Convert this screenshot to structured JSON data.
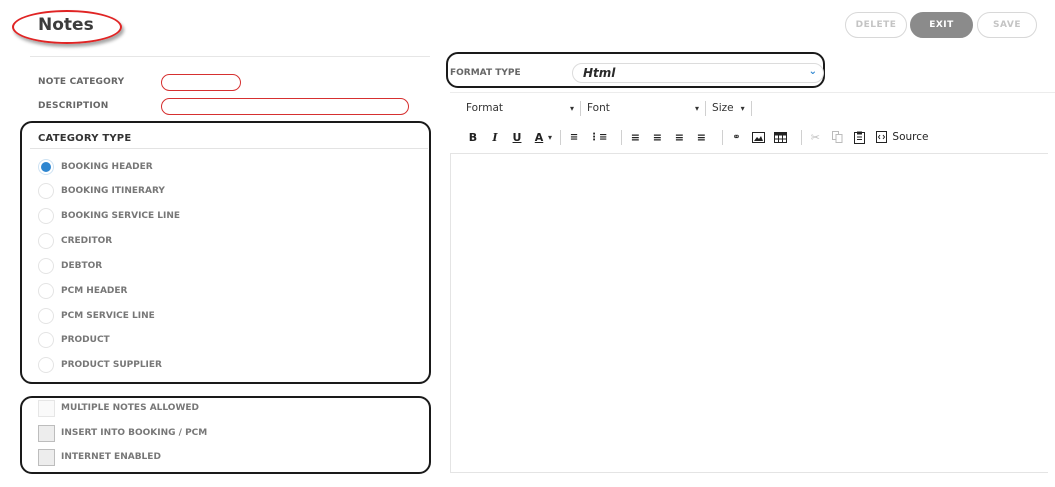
{
  "header": {
    "title": "Notes",
    "buttons": {
      "delete": "DELETE",
      "exit": "EXIT",
      "save": "SAVE"
    }
  },
  "form": {
    "note_category_label": "NOTE CATEGORY",
    "description_label": "DESCRIPTION",
    "note_category_value": "",
    "description_value": ""
  },
  "category_type": {
    "heading": "CATEGORY TYPE",
    "options": [
      {
        "label": "BOOKING HEADER",
        "selected": true
      },
      {
        "label": "BOOKING ITINERARY",
        "selected": false
      },
      {
        "label": "BOOKING SERVICE LINE",
        "selected": false
      },
      {
        "label": "CREDITOR",
        "selected": false
      },
      {
        "label": "DEBTOR",
        "selected": false
      },
      {
        "label": "PCM HEADER",
        "selected": false
      },
      {
        "label": "PCM SERVICE LINE",
        "selected": false
      },
      {
        "label": "PRODUCT",
        "selected": false
      },
      {
        "label": "PRODUCT SUPPLIER",
        "selected": false
      }
    ]
  },
  "flags": [
    {
      "label": "MULTIPLE NOTES ALLOWED",
      "checked": false
    },
    {
      "label": "INSERT INTO BOOKING / PCM",
      "checked": false
    },
    {
      "label": "INTERNET ENABLED",
      "checked": false
    }
  ],
  "format_type": {
    "label": "FORMAT TYPE",
    "value": "Html"
  },
  "editor": {
    "format_label": "Format",
    "font_label": "Font",
    "size_label": "Size",
    "source_label": "Source",
    "content": ""
  },
  "colors": {
    "accent": "#2e86d0",
    "highlight_red": "#d63030",
    "exit_bg": "#8b8b8b"
  }
}
